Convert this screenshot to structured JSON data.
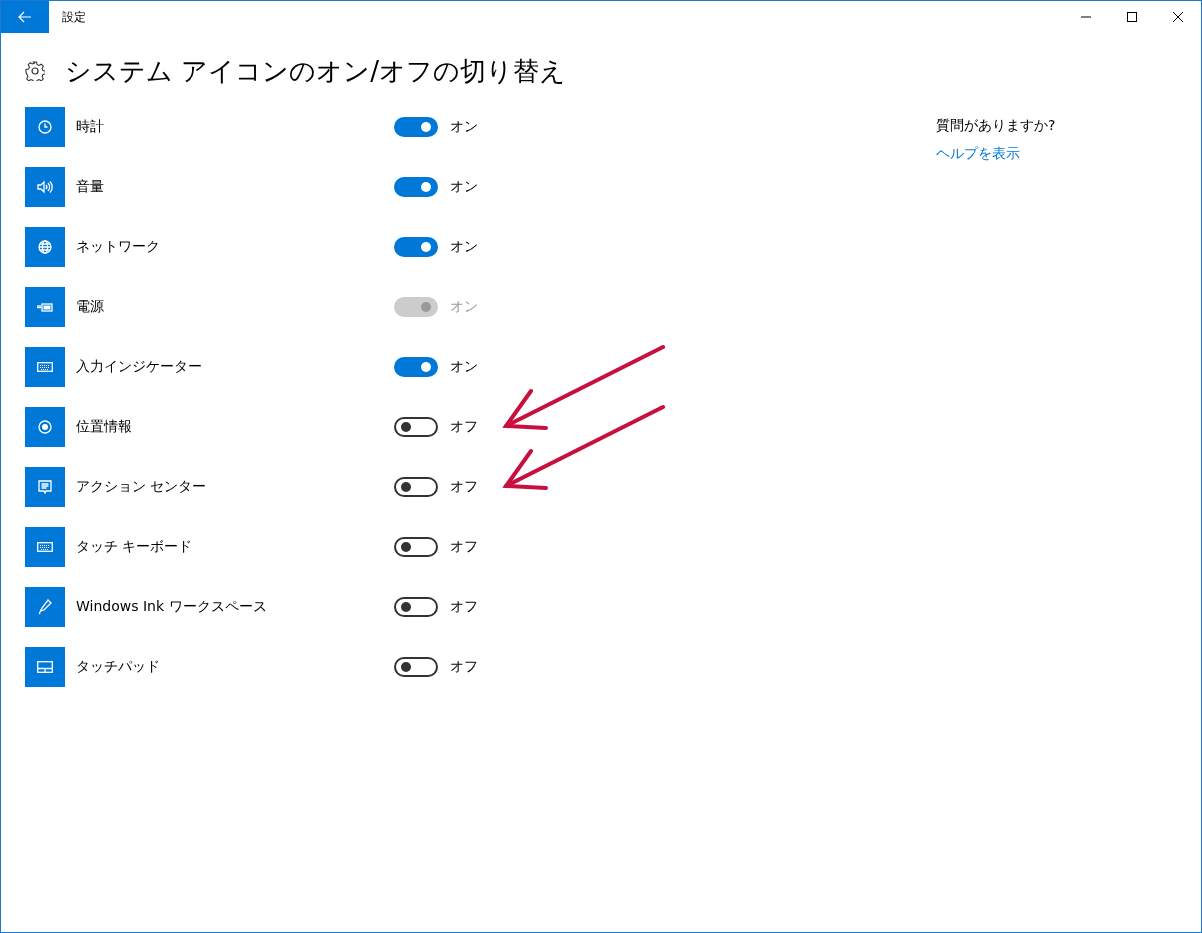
{
  "window": {
    "title": "設定"
  },
  "page": {
    "title": "システム アイコンのオン/オフの切り替え"
  },
  "items": [
    {
      "kind": "clock",
      "label": "時計",
      "on": true,
      "disabled": false,
      "state_text": "オン",
      "arrow": false
    },
    {
      "kind": "volume",
      "label": "音量",
      "on": true,
      "disabled": false,
      "state_text": "オン",
      "arrow": false
    },
    {
      "kind": "network",
      "label": "ネットワーク",
      "on": true,
      "disabled": false,
      "state_text": "オン",
      "arrow": false
    },
    {
      "kind": "power",
      "label": "電源",
      "on": true,
      "disabled": true,
      "state_text": "オン",
      "arrow": false
    },
    {
      "kind": "keyboard",
      "label": "入力インジケーター",
      "on": true,
      "disabled": false,
      "state_text": "オン",
      "arrow": false
    },
    {
      "kind": "location",
      "label": "位置情報",
      "on": false,
      "disabled": false,
      "state_text": "オフ",
      "arrow": true
    },
    {
      "kind": "action",
      "label": "アクション センター",
      "on": false,
      "disabled": false,
      "state_text": "オフ",
      "arrow": true
    },
    {
      "kind": "keyboard",
      "label": "タッチ キーボード",
      "on": false,
      "disabled": false,
      "state_text": "オフ",
      "arrow": false
    },
    {
      "kind": "pen",
      "label": "Windows Ink ワークスペース",
      "on": false,
      "disabled": false,
      "state_text": "オフ",
      "arrow": false
    },
    {
      "kind": "touchpad",
      "label": "タッチパッド",
      "on": false,
      "disabled": false,
      "state_text": "オフ",
      "arrow": false
    }
  ],
  "help": {
    "question": "質問がありますか?",
    "link": "ヘルプを表示"
  }
}
